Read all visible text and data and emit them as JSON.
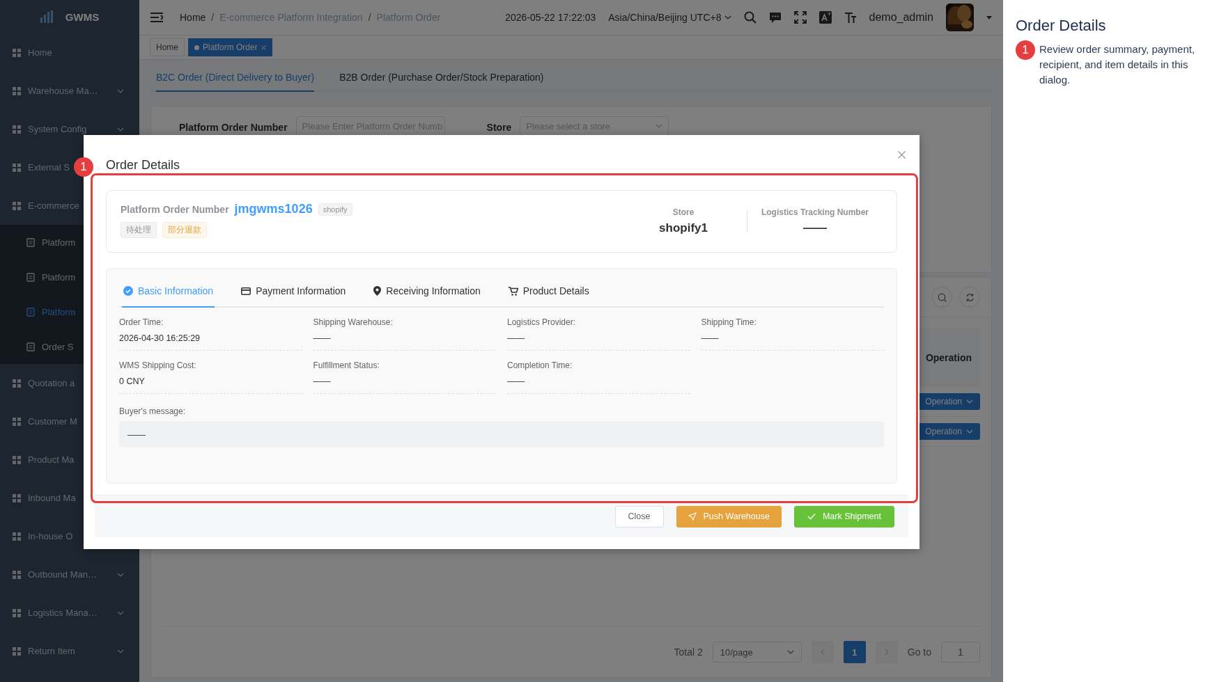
{
  "sidebar": {
    "logo": "GWMS",
    "items": [
      {
        "label": "Home",
        "chevron": false
      },
      {
        "label": "Warehouse Ma…",
        "chevron": true
      },
      {
        "label": "System Config",
        "chevron": true
      },
      {
        "label": "External S",
        "chevron": false
      },
      {
        "label": "E-commerce",
        "chevron": false,
        "children": [
          {
            "label": "Platform",
            "selected": false
          },
          {
            "label": "Platform",
            "selected": false
          },
          {
            "label": "Platform",
            "selected": true
          },
          {
            "label": "Order S",
            "selected": false
          }
        ]
      },
      {
        "label": "Quotation a",
        "chevron": false
      },
      {
        "label": "Customer M",
        "chevron": false
      },
      {
        "label": "Product Ma",
        "chevron": false
      },
      {
        "label": "Inbound Ma",
        "chevron": false
      },
      {
        "label": "In-house O",
        "chevron": false
      },
      {
        "label": "Outbound Man…",
        "chevron": true
      },
      {
        "label": "Logistics Mana…",
        "chevron": true
      },
      {
        "label": "Return Item",
        "chevron": true
      }
    ]
  },
  "header": {
    "breadcrumb": [
      {
        "label": "Home"
      },
      {
        "separator": "/",
        "label": "E-commerce Platform Integration"
      },
      {
        "separator": "/",
        "label": "Platform Order"
      }
    ],
    "datetime": "2026-05-22 17:22:03",
    "timezone": "Asia/China/Beijing UTC+8",
    "user": "demo_admin"
  },
  "tags_view": [
    {
      "label": "Home",
      "selected": false
    },
    {
      "label": "Platform Order",
      "selected": true
    }
  ],
  "page_tabs": [
    {
      "label": "B2C Order (Direct Delivery to Buyer)",
      "selected": true
    },
    {
      "label": "B2B Order (Purchase Order/Stock Preparation)",
      "selected": false
    }
  ],
  "search_form": [
    {
      "label": "Platform Order Number",
      "placeholder": "Please Enter Platform Order Numb",
      "kind": "input"
    },
    {
      "label": "Store",
      "placeholder": "Please select a store",
      "kind": "select"
    }
  ],
  "table": {
    "operation_header": "Operation",
    "rows": [
      {
        "operation": "Operation"
      },
      {
        "operation": "Operation"
      }
    ]
  },
  "pagination": {
    "total": "Total 2",
    "page_size": "10/page",
    "pages": [
      {
        "label": "1",
        "selected": true
      }
    ],
    "goto_label": "Go to",
    "goto_value": "1"
  },
  "dialog": {
    "badge": "1",
    "title": "Order Details",
    "summary": {
      "order_label": "Platform Order Number",
      "order_number": "jmgwms1026",
      "platform_tag": "shopify",
      "status_tags": [
        {
          "label": "待处理",
          "kind": "info"
        },
        {
          "label": "部分退款",
          "kind": "warning"
        }
      ],
      "store_label": "Store",
      "store_value": "shopify1",
      "tracking_label": "Logistics Tracking Number",
      "tracking_value": "——"
    },
    "tabs": [
      {
        "label": "Basic Information",
        "selected": true
      },
      {
        "label": "Payment Information",
        "selected": false
      },
      {
        "label": "Receiving Information",
        "selected": false
      },
      {
        "label": "Product Details",
        "selected": false
      }
    ],
    "fields": [
      {
        "label": "Order Time:",
        "value": "2026-04-30 16:25:29"
      },
      {
        "label": "Shipping Warehouse:",
        "value": "——"
      },
      {
        "label": "Logistics Provider:",
        "value": "——"
      },
      {
        "label": "Shipping Time:",
        "value": "——"
      },
      {
        "label": "WMS Shipping Cost:",
        "value": "0 CNY"
      },
      {
        "label": "Fulfillment Status:",
        "value": "——"
      },
      {
        "label": "Completion Time:",
        "value": "——"
      }
    ],
    "message": {
      "label": "Buyer's message:",
      "value": "——"
    },
    "buttons": [
      {
        "label": "Close",
        "kind": "default"
      },
      {
        "label": "Push Warehouse",
        "kind": "warning"
      },
      {
        "label": "Mark Shipment",
        "kind": "success"
      }
    ]
  },
  "annotation": {
    "badge": "1",
    "title": "Order Details",
    "description": "Review order summary, payment, recipient, and item details in this dialog."
  }
}
